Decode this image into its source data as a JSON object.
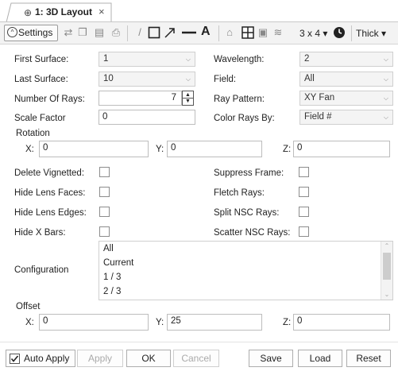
{
  "tab": {
    "icon": "⊕",
    "title": "1: 3D Layout",
    "close": "×"
  },
  "toolbar": {
    "settings_label": "Settings",
    "settings_icon": "chevron-up-icon",
    "grid_label": "3 x 4 ▾",
    "thickness_label": "Thick ▾"
  },
  "form": {
    "first_surface": {
      "label": "First Surface:",
      "value": "1"
    },
    "last_surface": {
      "label": "Last Surface:",
      "value": "10"
    },
    "number_of_rays": {
      "label": "Number Of Rays:",
      "value": "7"
    },
    "scale_factor": {
      "label": "Scale Factor",
      "value": "0"
    },
    "wavelength": {
      "label": "Wavelength:",
      "value": "2"
    },
    "field": {
      "label": "Field:",
      "value": "All"
    },
    "ray_pattern": {
      "label": "Ray Pattern:",
      "value": "XY Fan"
    },
    "color_rays_by": {
      "label": "Color Rays By:",
      "value": "Field #"
    },
    "rotation": {
      "title": "Rotation",
      "x_label": "X:",
      "x": "0",
      "y_label": "Y:",
      "y": "0",
      "z_label": "Z:",
      "z": "0"
    },
    "checks_left": [
      {
        "label": "Delete Vignetted:",
        "checked": false
      },
      {
        "label": "Hide Lens Faces:",
        "checked": false
      },
      {
        "label": "Hide Lens Edges:",
        "checked": false
      },
      {
        "label": "Hide X Bars:",
        "checked": false
      }
    ],
    "checks_right": [
      {
        "label": "Suppress Frame:",
        "checked": false
      },
      {
        "label": "Fletch Rays:",
        "checked": false
      },
      {
        "label": "Split NSC Rays:",
        "checked": false
      },
      {
        "label": "Scatter NSC Rays:",
        "checked": false
      }
    ],
    "configuration": {
      "label": "Configuration",
      "options": [
        "All",
        "Current",
        "1 / 3",
        "2 / 3"
      ]
    },
    "offset": {
      "title": "Offset",
      "x_label": "X:",
      "x": "0",
      "y_label": "Y:",
      "y": "25",
      "z_label": "Z:",
      "z": "0"
    }
  },
  "footer": {
    "auto_apply_label": "Auto Apply",
    "auto_apply_checked": true,
    "apply_label": "Apply",
    "ok_label": "OK",
    "cancel_label": "Cancel",
    "save_label": "Save",
    "load_label": "Load",
    "reset_label": "Reset"
  }
}
